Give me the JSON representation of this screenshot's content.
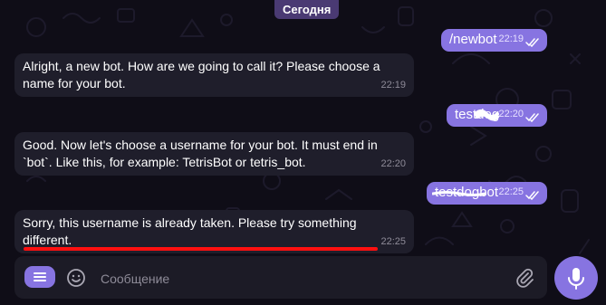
{
  "date_divider": "Сегодня",
  "messages": [
    {
      "direction": "out",
      "text": "/newbot",
      "time": "22:19",
      "status": "read"
    },
    {
      "direction": "in",
      "text": "Alright, a new bot. How are we going to call it? Please choose a name for your bot.",
      "time": "22:19"
    },
    {
      "direction": "out",
      "text": "testdog",
      "time": "22:20",
      "status": "read",
      "redacted": true
    },
    {
      "direction": "in",
      "text": "Good. Now let's choose a username for your bot. It must end in `bot`. Like this, for example: TetrisBot or tetris_bot.",
      "time": "22:20"
    },
    {
      "direction": "out",
      "text": "testdogbot",
      "time": "22:25",
      "status": "read",
      "strikethrough": true
    },
    {
      "direction": "in",
      "text": "Sorry, this username is already taken. Please try something different.",
      "time": "22:25",
      "highlighted": true
    }
  ],
  "composer": {
    "placeholder": "Сообщение"
  },
  "icons": {
    "menu": "menu-icon",
    "emoji": "emoji-icon",
    "attach": "paperclip-icon",
    "voice": "microphone-icon"
  },
  "colors": {
    "background": "#0f0d17",
    "incoming_bubble": "#1f1e2b",
    "outgoing_bubble": "#8774e1",
    "accent": "#8774e1",
    "highlight_underline": "#ff1010"
  }
}
